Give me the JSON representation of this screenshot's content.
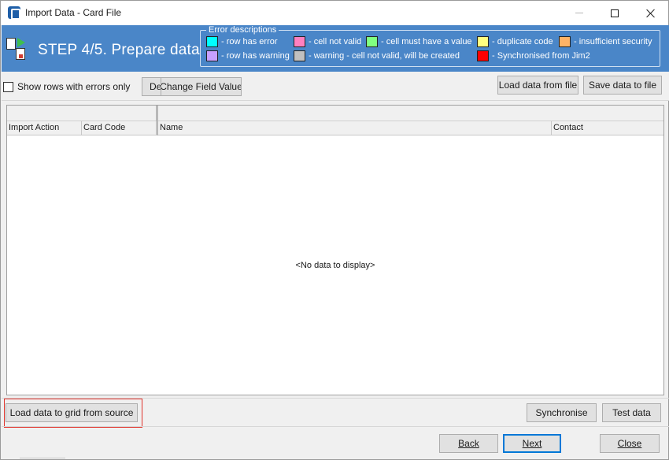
{
  "window": {
    "title": "Import Data - Card File"
  },
  "header": {
    "step_title": "STEP 4/5. Prepare data",
    "error_legend": "Error descriptions",
    "errors": [
      {
        "color": "#00ffff",
        "label": "- row has error"
      },
      {
        "color": "#ff80c0",
        "label": "- cell not valid"
      },
      {
        "color": "#80ff80",
        "label": "- cell must have a value"
      },
      {
        "color": "#ffff80",
        "label": "- duplicate code"
      },
      {
        "color": "#ffb366",
        "label": "- insufficient security"
      },
      {
        "color": "#c8a0ff",
        "label": "- row has warning"
      },
      {
        "color": "#c0c0c0",
        "label": "- warning - cell not valid, will be created"
      },
      {
        "color": "#ff0000",
        "label": "- Synchronised from Jim2"
      }
    ]
  },
  "toolbar": {
    "show_errors_label": "Show rows with errors only",
    "show_errors_checked": false,
    "delete_label": "De",
    "change_field_label": "Change Field Value",
    "load_file_label": "Load data from file",
    "save_file_label": "Save data to file"
  },
  "grid": {
    "columns": [
      "Import Action",
      "Card Code",
      "Name",
      "Contact"
    ],
    "empty_text": "<No data to display>"
  },
  "actions": {
    "load_source_label": "Load data to grid from source",
    "synchronise_label": "Synchronise",
    "test_label": "Test data"
  },
  "footer": {
    "back_label": "Back",
    "next_label": "Next",
    "close_label": "Close"
  },
  "colors": {
    "header_bg": "#4a86c8",
    "highlight_border": "#e0332b",
    "default_button_border": "#0078d7"
  }
}
